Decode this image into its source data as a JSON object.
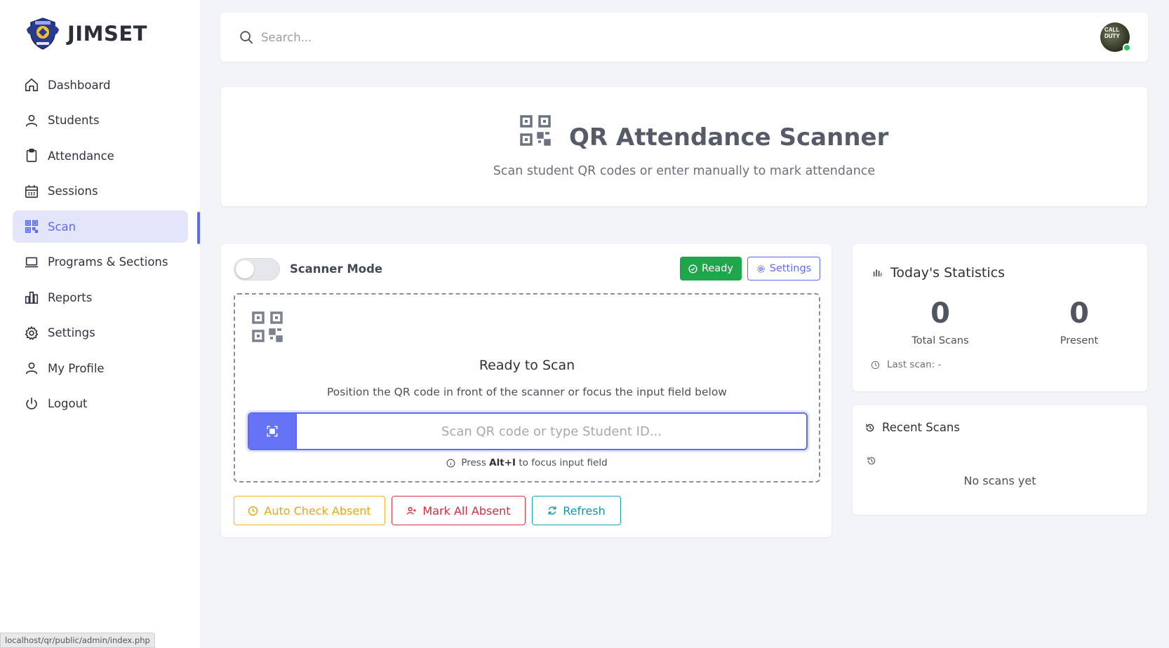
{
  "brand": {
    "name": "JIMSET",
    "logo_icon": "shield-crest-logo"
  },
  "sidebar": {
    "items": [
      {
        "label": "Dashboard",
        "icon": "home-icon",
        "active": false
      },
      {
        "label": "Students",
        "icon": "user-icon",
        "active": false
      },
      {
        "label": "Attendance",
        "icon": "clipboard-icon",
        "active": false
      },
      {
        "label": "Sessions",
        "icon": "calendar-icon",
        "active": false
      },
      {
        "label": "Scan",
        "icon": "qr-scan-icon",
        "active": true
      },
      {
        "label": "Programs & Sections",
        "icon": "laptop-icon",
        "active": false
      },
      {
        "label": "Reports",
        "icon": "bar-chart-icon",
        "active": false
      },
      {
        "label": "Settings",
        "icon": "gear-icon",
        "active": false
      },
      {
        "label": "My Profile",
        "icon": "user-icon",
        "active": false
      },
      {
        "label": "Logout",
        "icon": "power-icon",
        "active": false
      }
    ],
    "accent": "#5c6cf2"
  },
  "topbar": {
    "search_placeholder": "Search...",
    "avatar_text": "CALL DUTY",
    "online": true
  },
  "header": {
    "title": "QR Attendance Scanner",
    "subtitle": "Scan student QR codes or enter manually to mark attendance"
  },
  "scanner": {
    "mode_label": "Scanner Mode",
    "mode_enabled": false,
    "status_label": "Ready",
    "settings_label": "Settings",
    "zone_title": "Ready to Scan",
    "zone_desc": "Position the QR code in front of the scanner or focus the input field below",
    "input_placeholder": "Scan QR code or type Student ID...",
    "input_value": "",
    "hint_prefix": "Press",
    "hint_key": "Alt+I",
    "hint_suffix": "to focus input field",
    "actions": {
      "auto_check": "Auto Check Absent",
      "mark_all": "Mark All Absent",
      "refresh": "Refresh"
    }
  },
  "stats": {
    "title": "Today's Statistics",
    "total_scans_value": "0",
    "total_scans_label": "Total Scans",
    "present_value": "0",
    "present_label": "Present",
    "last_scan_label": "Last scan:",
    "last_scan_value": "-"
  },
  "recent": {
    "title": "Recent Scans",
    "empty_text": "No scans yet"
  },
  "status_bar": {
    "url": "localhost/qr/public/admin/index.php"
  },
  "colors": {
    "primary": "#5c6cf2",
    "success": "#1fa64a",
    "warning": "#f1b419",
    "danger": "#dc3545",
    "info": "#1aa3b5"
  }
}
